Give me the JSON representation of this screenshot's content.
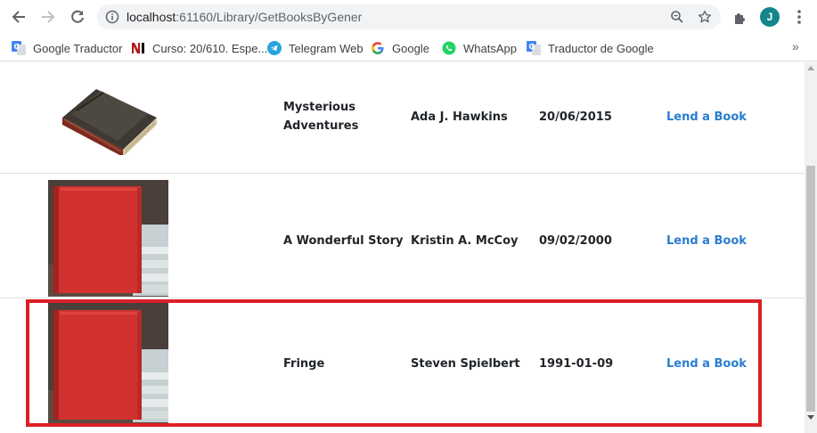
{
  "browser": {
    "url_host": "localhost",
    "url_rest": ":61160/Library/GetBooksByGener",
    "profile_initial": "J",
    "accent_color": "#14858c"
  },
  "bookmarks": [
    {
      "label": "Google Traductor",
      "icon": "google-translate-icon"
    },
    {
      "label": "Curso: 20/610. Espe...",
      "icon": "course-ni-icon"
    },
    {
      "label": "Telegram Web",
      "icon": "telegram-icon"
    },
    {
      "label": "Google",
      "icon": "google-icon"
    },
    {
      "label": "WhatsApp",
      "icon": "whatsapp-icon"
    },
    {
      "label": "Traductor de Google",
      "icon": "google-translate-icon"
    }
  ],
  "bookmarks_more": "»",
  "books": [
    {
      "title_line1": "Mysterious",
      "title_line2": "Adventures",
      "author": "Ada J. Hawkins",
      "date": "20/06/2015",
      "action": "Lend a Book",
      "cover": "old-brown-book"
    },
    {
      "title": "A Wonderful Story",
      "author": "Kristin A. McCoy",
      "date": "09/02/2000",
      "action": "Lend a Book",
      "cover": "red-book"
    },
    {
      "title": "Fringe",
      "author": "Steven Spielbert",
      "date": "1991-01-09",
      "action": "Lend a Book",
      "cover": "red-book"
    }
  ],
  "colors": {
    "link": "#2a7dd1",
    "highlight": "#dc1f27"
  }
}
